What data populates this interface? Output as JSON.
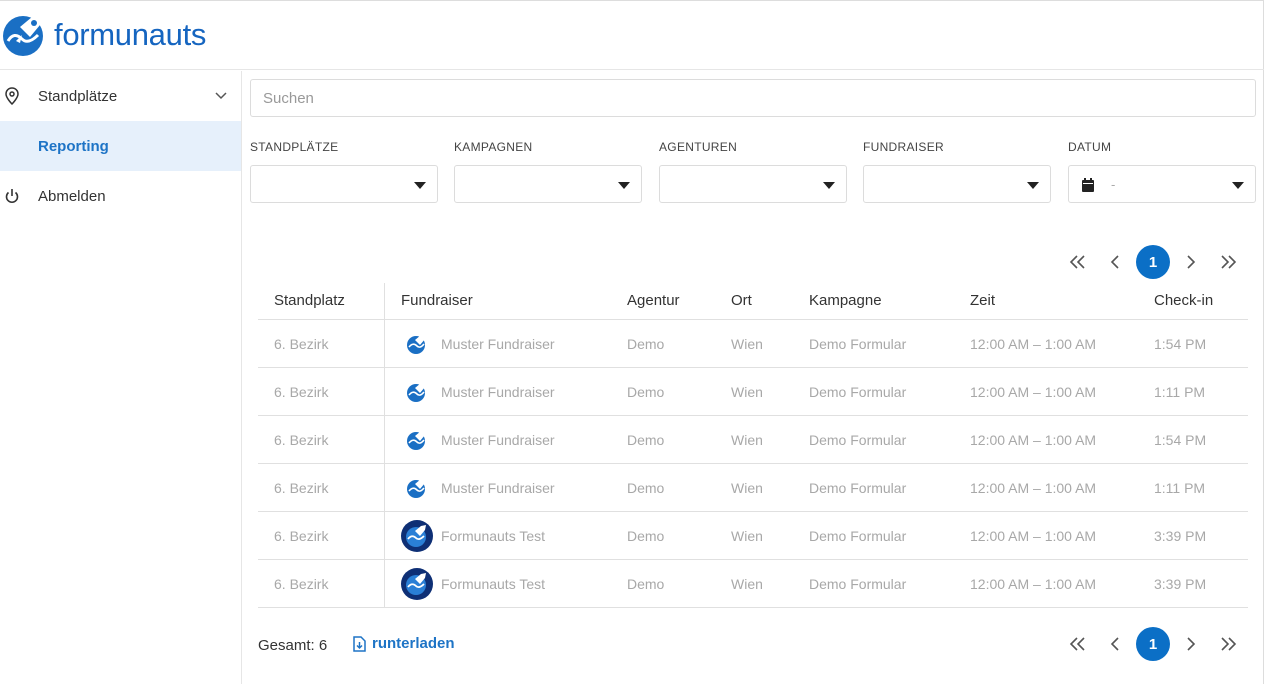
{
  "brand": {
    "name": "formunauts",
    "color": "#1565c0",
    "icon": "rocket-globe-logo"
  },
  "sidebar": {
    "items": [
      {
        "label": "Standplätze",
        "icon": "map-pin-icon",
        "expandable": true
      },
      {
        "label": "Reporting",
        "active": true
      },
      {
        "label": "Abmelden",
        "icon": "power-icon"
      }
    ]
  },
  "search": {
    "placeholder": "Suchen",
    "value": ""
  },
  "filters": [
    {
      "label": "STANDPLÄTZE",
      "value": ""
    },
    {
      "label": "KAMPAGNEN",
      "value": ""
    },
    {
      "label": "AGENTUREN",
      "value": ""
    },
    {
      "label": "FUNDRAISER",
      "value": ""
    },
    {
      "label": "DATUM",
      "value": "-",
      "icon": "calendar-icon"
    }
  ],
  "pagination": {
    "current_page": "1",
    "accent": "#0b6fc6"
  },
  "table": {
    "columns": [
      "Standplatz",
      "Fundraiser",
      "Agentur",
      "Ort",
      "Kampagne",
      "Zeit",
      "Check-in"
    ],
    "rows": [
      {
        "standplatz": "6. Bezirk",
        "fundraiser": "Muster Fundraiser",
        "avatar": "small",
        "agentur": "Demo",
        "ort": "Wien",
        "kampagne": "Demo Formular",
        "zeit": "12:00 AM – 1:00 AM",
        "checkin": "1:54 PM"
      },
      {
        "standplatz": "6. Bezirk",
        "fundraiser": "Muster Fundraiser",
        "avatar": "small",
        "agentur": "Demo",
        "ort": "Wien",
        "kampagne": "Demo Formular",
        "zeit": "12:00 AM – 1:00 AM",
        "checkin": "1:11 PM"
      },
      {
        "standplatz": "6. Bezirk",
        "fundraiser": "Muster Fundraiser",
        "avatar": "small",
        "agentur": "Demo",
        "ort": "Wien",
        "kampagne": "Demo Formular",
        "zeit": "12:00 AM – 1:00 AM",
        "checkin": "1:54 PM"
      },
      {
        "standplatz": "6. Bezirk",
        "fundraiser": "Muster Fundraiser",
        "avatar": "small",
        "agentur": "Demo",
        "ort": "Wien",
        "kampagne": "Demo Formular",
        "zeit": "12:00 AM – 1:00 AM",
        "checkin": "1:11 PM"
      },
      {
        "standplatz": "6. Bezirk",
        "fundraiser": "Formunauts Test",
        "avatar": "big",
        "agentur": "Demo",
        "ort": "Wien",
        "kampagne": "Demo Formular",
        "zeit": "12:00 AM – 1:00 AM",
        "checkin": "3:39 PM"
      },
      {
        "standplatz": "6. Bezirk",
        "fundraiser": "Formunauts Test",
        "avatar": "big",
        "agentur": "Demo",
        "ort": "Wien",
        "kampagne": "Demo Formular",
        "zeit": "12:00 AM – 1:00 AM",
        "checkin": "3:39 PM"
      }
    ]
  },
  "footer": {
    "total": "Gesamt: 6",
    "download_label": "runterladen"
  }
}
